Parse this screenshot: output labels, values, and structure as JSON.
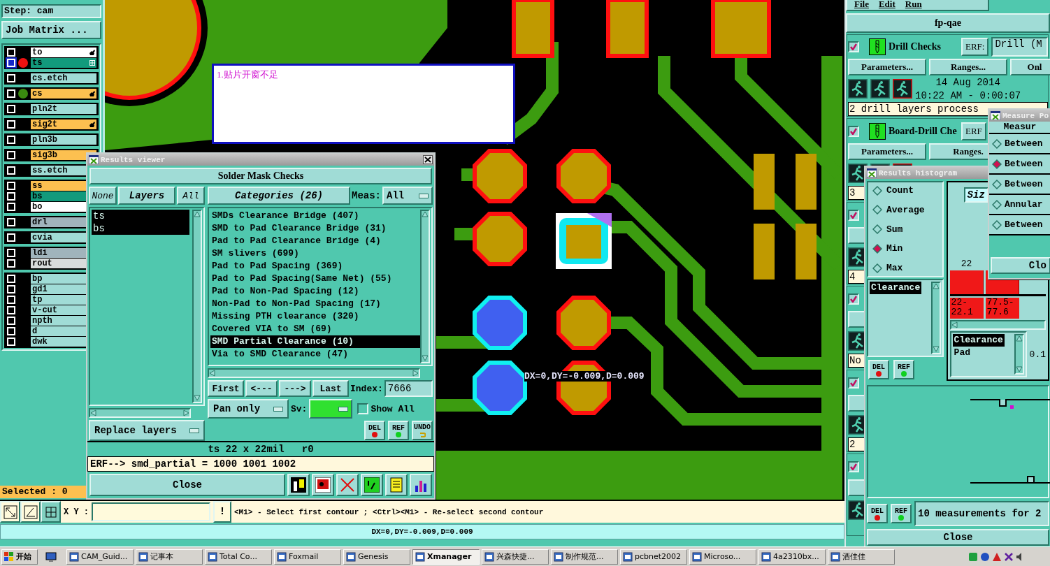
{
  "left_panel": {
    "step": "Step: cam",
    "job_matrix": "Job Matrix ...",
    "layer_groups": [
      [
        {
          "name": "to",
          "color": "#ffffff",
          "selected": false,
          "kind": "hand"
        },
        {
          "name": "ts",
          "color": "#129a7c",
          "selected": true,
          "marker": {
            "color": "#ee1111"
          },
          "kind": "grid"
        }
      ],
      [
        {
          "name": "cs.etch",
          "color": "#a0dcd6",
          "selected": false,
          "kind": "plain"
        }
      ],
      [
        {
          "name": "cs",
          "color": "#fcc050",
          "selected": false,
          "marker": {
            "color": "#3a8a10"
          },
          "kind": "hand"
        }
      ],
      [
        {
          "name": "pln2t",
          "color": "#a0dcd6",
          "selected": false,
          "kind": "plain"
        }
      ],
      [
        {
          "name": "sig2t",
          "color": "#fcc050",
          "selected": false,
          "kind": "hand"
        }
      ],
      [
        {
          "name": "pln3b",
          "color": "#a0dcd6",
          "selected": false,
          "kind": "plain"
        }
      ],
      [
        {
          "name": "sig3b",
          "color": "#fcc050",
          "selected": false,
          "kind": "hand"
        }
      ],
      [
        {
          "name": "ss.etch",
          "color": "#a0dcd6",
          "selected": false,
          "kind": "plain"
        }
      ],
      [
        {
          "name": "ss",
          "color": "#fcc050",
          "selected": false,
          "kind": "hand"
        },
        {
          "name": "bs",
          "color": "#129a7c",
          "selected": false,
          "kind": "hand"
        },
        {
          "name": "bo",
          "color": "#ffffff",
          "selected": false,
          "kind": "hand"
        }
      ],
      [
        {
          "name": "drl",
          "color": "#a0b4bc",
          "selected": false,
          "kind": "plain"
        }
      ],
      [
        {
          "name": "cvia",
          "color": "#a0dcd6",
          "selected": false,
          "kind": "plain"
        }
      ],
      [
        {
          "name": "ldi",
          "color": "#a0b4bc",
          "selected": false,
          "kind": "plain"
        },
        {
          "name": "rout",
          "color": "#d8dcdc",
          "selected": false,
          "kind": "plain"
        }
      ],
      [
        {
          "name": "bp",
          "color": "#a0dcd6",
          "selected": false,
          "kind": "plain"
        },
        {
          "name": "gd1",
          "color": "#a0dcd6",
          "selected": false,
          "kind": "plain"
        },
        {
          "name": "tp",
          "color": "#a0dcd6",
          "selected": false,
          "kind": "plain"
        },
        {
          "name": "v-cut",
          "color": "#a0dcd6",
          "selected": false,
          "kind": "plain"
        },
        {
          "name": "npth",
          "color": "#a0dcd6",
          "selected": false,
          "kind": "plain"
        },
        {
          "name": "d",
          "color": "#a0dcd6",
          "selected": false,
          "kind": "plain"
        },
        {
          "name": "dwk",
          "color": "#a0dcd6",
          "selected": false,
          "kind": "plain"
        }
      ]
    ],
    "selected_count": "Selected : 0"
  },
  "canvas": {
    "note": "1.贴片开窗不足",
    "measure_label": "DX=0,DY=-0.009,D=0.009"
  },
  "results_viewer": {
    "title": "Results viewer",
    "header": "Solder Mask Checks",
    "layer_buttons": [
      "None",
      "Layers",
      "All"
    ],
    "layers": [
      {
        "name": "ts",
        "selected": true
      },
      {
        "name": "bs",
        "selected": true
      }
    ],
    "categories_button": "Categories (26)",
    "meas_label": "Meas:",
    "meas_value": "All",
    "categories": [
      {
        "label": "SMDs Clearance Bridge (407)",
        "selected": false
      },
      {
        "label": "SMD to Pad Clearance Bridge (31)",
        "selected": false
      },
      {
        "label": "Pad to Pad Clearance Bridge (4)",
        "selected": false
      },
      {
        "label": "SM slivers (699)",
        "selected": false
      },
      {
        "label": "Pad to Pad Spacing (369)",
        "selected": false
      },
      {
        "label": "Pad to Pad Spacing(Same Net) (55)",
        "selected": false
      },
      {
        "label": "Pad to Non-Pad Spacing (12)",
        "selected": false
      },
      {
        "label": "Non-Pad to Non-Pad Spacing (17)",
        "selected": false
      },
      {
        "label": "Missing PTH clearance (320)",
        "selected": false
      },
      {
        "label": "Covered VIA to SM (69)",
        "selected": false
      },
      {
        "label": "SMD Partial Clearance (10)",
        "selected": true
      },
      {
        "label": "Via to SMD Clearance (47)",
        "selected": false
      }
    ],
    "nav_buttons": [
      "First",
      "<---",
      "--->",
      "Last"
    ],
    "index_label": "Index:",
    "index_value": "7666",
    "mode": "Pan only",
    "sv_label": "Sv:",
    "show_all": {
      "label": "Show All",
      "checked": false
    },
    "replace": "Replace layers",
    "action_buttons": [
      {
        "label": "DEL",
        "kind": "del"
      },
      {
        "label": "REF",
        "kind": "ref"
      },
      {
        "label": "UNDO",
        "kind": "undo"
      }
    ],
    "info": "ts 22 x 22mil   r0",
    "erf": "ERF--> smd_partial = 1000 1001 1002",
    "close": "Close"
  },
  "command_bar": {
    "xy_label": "X Y :",
    "bang": "!",
    "message": "<M1> - Select first contour ; <Ctrl><M1> - Re-select second contour"
  },
  "status_bar": "DX=0,DY=-0.009,D=0.009",
  "qae": {
    "menu": [
      "File",
      "Edit",
      "Run"
    ],
    "title": "fp-qae",
    "checks": [
      {
        "checked": true,
        "name": "Drill Checks",
        "erf_label": "ERF:",
        "erf_value": "Drill (M",
        "buttons": [
          "Parameters...",
          "Ranges...",
          "Onl"
        ],
        "date": "14 Aug 2014",
        "time": "10:22 AM - 0:00:07",
        "status": "2 drill layers process"
      },
      {
        "checked": true,
        "name": "Board-Drill Che",
        "erf_label": "ERF",
        "buttons": [
          "Parameters...",
          "Ranges."
        ],
        "status": "3"
      },
      {
        "checked": true,
        "status": "4"
      },
      {
        "checked": true,
        "status": "No"
      },
      {
        "checked": true,
        "status": "2"
      },
      {
        "checked": true
      }
    ]
  },
  "histogram": {
    "title": "Results histogram",
    "modes": [
      {
        "label": "Count",
        "selected": false
      },
      {
        "label": "Average",
        "selected": false
      },
      {
        "label": "Sum",
        "selected": false
      },
      {
        "label": "Min",
        "selected": true
      },
      {
        "label": "Max",
        "selected": false
      }
    ],
    "list": [
      {
        "label": "Clearance",
        "selected": true
      }
    ],
    "size_label": "Siz",
    "bars": [
      {
        "label": "22",
        "bin": [
          "22-",
          "22.1"
        ]
      },
      {
        "bin": [
          "77.5-",
          "77.6"
        ]
      }
    ],
    "types": [
      {
        "label": "Clearance",
        "selected": true
      },
      {
        "label": "Pad",
        "selected": false
      }
    ],
    "step": "0.1",
    "list_buttons": [
      {
        "label": "DEL",
        "kind": "del"
      },
      {
        "label": "REF",
        "kind": "ref"
      }
    ],
    "bottom_buttons": [
      {
        "label": "DEL",
        "kind": "del"
      },
      {
        "label": "REF",
        "kind": "ref"
      }
    ],
    "message": "10 measurements for 2",
    "close": "Close"
  },
  "measure": {
    "title": "Measure Po",
    "header": "Measur",
    "options": [
      {
        "label": "Between",
        "selected": false
      },
      {
        "label": "Between",
        "selected": true
      },
      {
        "label": "Between",
        "selected": false
      },
      {
        "label": "Annular",
        "selected": false
      },
      {
        "label": "Between",
        "selected": false
      }
    ],
    "close": "Clo"
  },
  "taskbar": {
    "start": "开始",
    "tasks": [
      {
        "label": "CAM_Guid...",
        "selected": false
      },
      {
        "label": "记事本",
        "selected": false
      },
      {
        "label": "Total Co...",
        "selected": false
      },
      {
        "label": "Foxmail",
        "selected": false
      },
      {
        "label": "Genesis",
        "selected": false
      },
      {
        "label": "Xmanager",
        "selected": true
      },
      {
        "label": "兴森快捷...",
        "selected": false
      },
      {
        "label": "制作规范...",
        "selected": false
      },
      {
        "label": "pcbnet2002",
        "selected": false
      },
      {
        "label": "Microso...",
        "selected": false
      },
      {
        "label": "4a2310bx...",
        "selected": false
      },
      {
        "label": "酒佳佳",
        "selected": false
      }
    ]
  }
}
